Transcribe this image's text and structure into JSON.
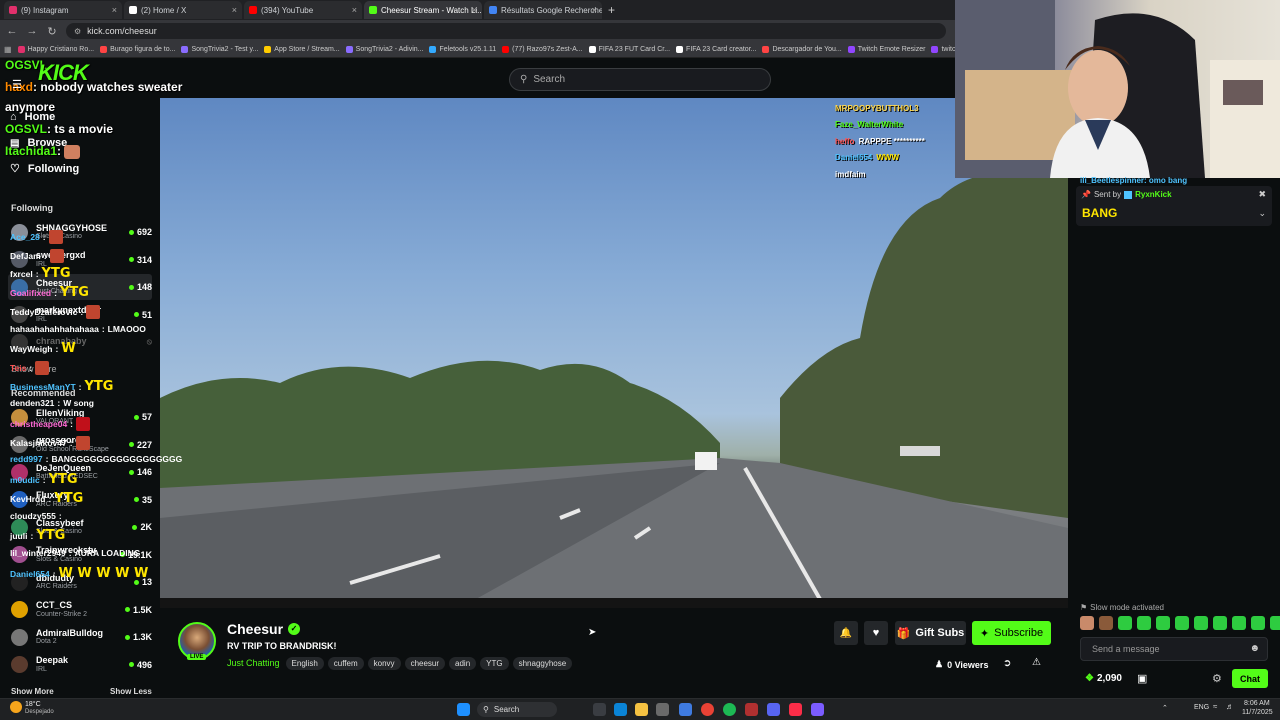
{
  "browser": {
    "tabs": [
      {
        "title": "(9) Instagram",
        "color": "#e1306c"
      },
      {
        "title": "(2) Home / X",
        "color": "#ffffff"
      },
      {
        "title": "(394) YouTube",
        "color": "#ff0000"
      },
      {
        "title": "Cheesur Stream - Watch Li...",
        "color": "#53fc18"
      },
      {
        "title": "Résultats Google Recherche d'I",
        "color": "#4285f4"
      }
    ],
    "url": "kick.com/cheesur",
    "bookmarks": [
      {
        "label": "Happy Cristiano Ro...",
        "color": "#e1306c"
      },
      {
        "label": "Burago figura de to...",
        "color": "#ff4444"
      },
      {
        "label": "SongTrivia2 - Test y...",
        "color": "#8a6cff"
      },
      {
        "label": "App Store / Stream...",
        "color": "#ffcc00"
      },
      {
        "label": "SongTrivia2 - Adivin...",
        "color": "#8a6cff"
      },
      {
        "label": "Feletools v25.1.11",
        "color": "#33aaff"
      },
      {
        "label": "(77) Razo97s Zest-A...",
        "color": "#ff0000"
      },
      {
        "label": "FIFA 23 FUT Card Cr...",
        "color": "#ffffff"
      },
      {
        "label": "FIFA 23 Card creator...",
        "color": "#ffffff"
      },
      {
        "label": "Descargador de You...",
        "color": "#ff4444"
      },
      {
        "label": "Twitch Emote Resizer",
        "color": "#9146ff"
      },
      {
        "label": "twitch emote resize...",
        "color": "#9146ff"
      }
    ]
  },
  "search": {
    "placeholder": "Search"
  },
  "overlay": {
    "logo": "KICK",
    "lines": [
      {
        "user": "OGSVL",
        "text": "",
        "color": "#53fc18"
      },
      {
        "user": "haxd",
        "text": ": nobody watches sweater",
        "color": "#ff8a00"
      },
      {
        "user": "",
        "text": "anymore",
        "color": "#ffffff"
      },
      {
        "user": "OGSVL",
        "text": ": ts a movie",
        "color": "#53fc18"
      },
      {
        "user": "Itachida1",
        "text": ":",
        "color": "#53fc18"
      }
    ]
  },
  "nav": {
    "home": "Home",
    "browse": "Browse",
    "following": "Following"
  },
  "sidebar": {
    "following_heading": "Following",
    "following": [
      {
        "name": "SHNAGGYHOSE",
        "category": "Slots & Casino",
        "viewers": "692",
        "color": "#8a8f99",
        "selected": false
      },
      {
        "name": "sweatergxd",
        "category": "IRL",
        "viewers": "314",
        "color": "#555a66",
        "selected": false
      },
      {
        "name": "Cheesur",
        "category": "Just Chatting",
        "viewers": "148",
        "color": "#3a6ea5",
        "selected": true
      },
      {
        "name": "markynextdoor",
        "category": "IRL",
        "viewers": "51",
        "color": "#444",
        "selected": false
      },
      {
        "name": "chranababy",
        "category": "",
        "viewers": "",
        "color": "#333",
        "selected": false
      }
    ],
    "show_more": "Show More",
    "recommended_heading": "Recommended",
    "recommended": [
      {
        "name": "EllenViking",
        "category": "VALORANT",
        "viewers": "57",
        "color": "#c58f3d"
      },
      {
        "name": "grossgore",
        "category": "Old School RuneScape",
        "viewers": "227",
        "color": "#6a6a6a"
      },
      {
        "name": "DeJenQueen",
        "category": "Battlefield REDSEC",
        "viewers": "146",
        "color": "#b0306a"
      },
      {
        "name": "Fluxury",
        "category": "ARC Raiders",
        "viewers": "35",
        "color": "#1f5fbf"
      },
      {
        "name": "Classybeef",
        "category": "Slots & Casino",
        "viewers": "2K",
        "color": "#2e8b57"
      },
      {
        "name": "Trainwreckstv",
        "category": "Slots & Casino",
        "viewers": "19.1K",
        "color": "#a04f8f"
      },
      {
        "name": "dbldudty",
        "category": "ARC Raiders",
        "viewers": "13",
        "color": "#222"
      },
      {
        "name": "CCT_CS",
        "category": "Counter-Strike 2",
        "viewers": "1.5K",
        "color": "#e0a100"
      },
      {
        "name": "AdmiralBulldog",
        "category": "Dota 2",
        "viewers": "1.3K",
        "color": "#777"
      },
      {
        "name": "Deepak",
        "category": "IRL",
        "viewers": "496",
        "color": "#5a3b2e"
      }
    ],
    "show_more_2": "Show More",
    "show_less": "Show Less"
  },
  "video_overlay_chat": [
    {
      "user": "MRPOOPYBUTTHOL3",
      "text": "",
      "color": "#ffd84d"
    },
    {
      "user": "Faze_WalterWhite",
      "text": "",
      "color": "#53fc18"
    },
    {
      "user": "heffo",
      "text": "RAPPPE **********",
      "color": "#ff5555"
    },
    {
      "user": "Daniel654",
      "text": "WWW",
      "color": "#4fc3ff"
    },
    {
      "user": "imdfaim",
      "text": "",
      "color": "#ffffff"
    }
  ],
  "stream": {
    "streamer": "Cheesur",
    "title": "RV TRIP TO BRANDRISK!",
    "category": "Just Chatting",
    "live_badge": "LIVE",
    "tags": [
      "English",
      "cuffem",
      "konvy",
      "cheesur",
      "adin",
      "YTG",
      "shnaggyhose"
    ],
    "viewers": "0 Viewers",
    "gift_subs": "Gift Subs",
    "subscribe": "Subscribe"
  },
  "chat": {
    "pinned_from": "Sent by",
    "pinned_user": "RyxnKick",
    "pinned_text": "BANG",
    "top_partial": "ili_Beetlespinner: omo bang",
    "messages": [
      {
        "user": "Ace_28",
        "text": "",
        "color": "#4fc3ff",
        "emote": "#c0452f"
      },
      {
        "user": "DefJam",
        "text": "",
        "color": "#ffffff",
        "emote": "#c0452f"
      },
      {
        "user": "fxrcel",
        "text": "",
        "color": "#ffffff",
        "big": "YTG"
      },
      {
        "user": "Goalifixed",
        "text": "",
        "color": "#ff6bd6",
        "big": "YTG"
      },
      {
        "user": "TeddyDzaferovic",
        "text": "",
        "color": "#ffffff",
        "emote": "#c0452f"
      },
      {
        "user": "hahaahahahhahahaaa",
        "text": "LMAOOO",
        "color": "#ffffff"
      },
      {
        "user": "WayWeigh",
        "text": "",
        "color": "#ffffff",
        "big": "W"
      },
      {
        "user": "Teis",
        "text": "",
        "color": "#ff5555",
        "emote": "#c0452f"
      },
      {
        "user": "BusinessManYT",
        "text": "",
        "color": "#4fc3ff",
        "big": "YTG"
      },
      {
        "user": "denden321",
        "text": "W song",
        "color": "#ffffff"
      },
      {
        "user": "christheape04",
        "text": "",
        "color": "#ff6bd6",
        "emote": "#c0101a"
      },
      {
        "user": "Kalasjnikov47",
        "text": "",
        "color": "#ffffff",
        "emote": "#c0452f"
      },
      {
        "user": "redd997",
        "text": "BANGGGGGGGGGGGGGGGGG",
        "color": "#4fc3ff"
      },
      {
        "user": "m0udic",
        "text": "",
        "color": "#4fc3ff",
        "big": "YTG"
      },
      {
        "user": "KevHrdd",
        "text": "",
        "color": "#ffffff",
        "big": "YTG"
      },
      {
        "user": "cloudzy555",
        "text": "",
        "color": "#ffffff"
      },
      {
        "user": "juuli",
        "text": "",
        "color": "#ffffff",
        "big": "YTG"
      },
      {
        "user": "lil_winter2949",
        "text": "AURA LOADING",
        "color": "#ffffff"
      },
      {
        "user": "Daniel654",
        "text": "",
        "color": "#4fc3ff",
        "big": "W W W W W"
      }
    ],
    "slow_mode": "Slow mode activated",
    "input_placeholder": "Send a message",
    "points": "2,090",
    "chat_button": "Chat"
  },
  "taskbar": {
    "weather_temp": "18°C",
    "weather_desc": "Despejado",
    "search": "Search",
    "lang": "ENG",
    "time": "8:06 AM",
    "date": "11/7/2025"
  }
}
